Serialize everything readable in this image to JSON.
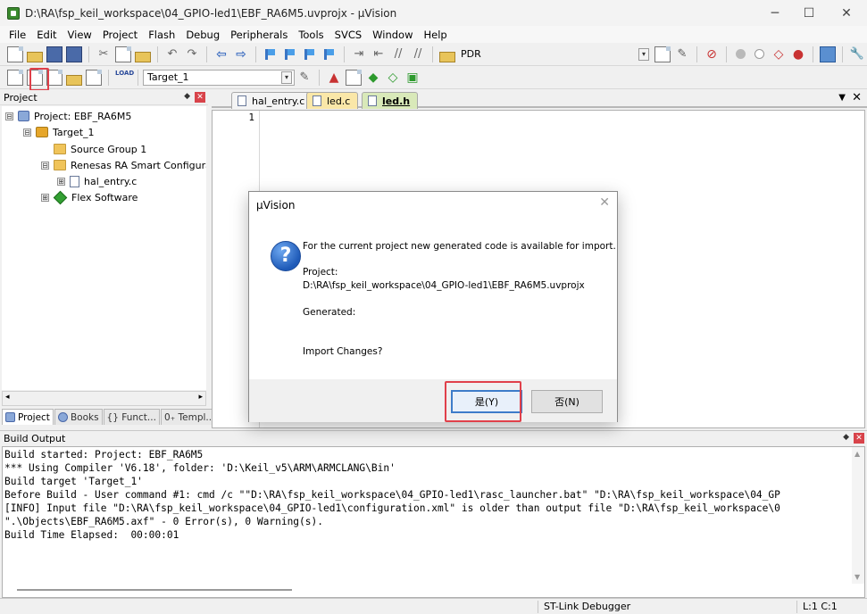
{
  "window": {
    "title": "D:\\RA\\fsp_keil_workspace\\04_GPIO-led1\\EBF_RA6M5.uvprojx - µVision",
    "controls": {
      "minimize": "─",
      "maximize": "☐",
      "close": "✕"
    }
  },
  "menu": [
    "File",
    "Edit",
    "View",
    "Project",
    "Flash",
    "Debug",
    "Peripherals",
    "Tools",
    "SVCS",
    "Window",
    "Help"
  ],
  "toolbar1": {
    "pdr_label": "PDR"
  },
  "toolbar2": {
    "target_select": "Target_1",
    "load_label": "LOAD"
  },
  "project_panel": {
    "title": "Project",
    "tree": [
      {
        "label": "Project: EBF_RA6M5",
        "expander": "⊟",
        "icon": "project-icon"
      },
      {
        "label": "Target_1",
        "expander": "⊟",
        "icon": "target-icon"
      },
      {
        "label": "Source Group 1",
        "expander": "",
        "icon": "folder-icon"
      },
      {
        "label": "Renesas RA Smart Configurato",
        "expander": "⊟",
        "icon": "folder-icon"
      },
      {
        "label": "hal_entry.c",
        "expander": "⊞",
        "icon": "file-icon"
      },
      {
        "label": "Flex Software",
        "expander": "⊞",
        "icon": "gem-icon"
      }
    ],
    "tabs": [
      {
        "label": "Project",
        "icon": "project-tab-icon"
      },
      {
        "label": "Books",
        "icon": "books-icon"
      },
      {
        "label": "{} Funct...",
        "icon": "functions-icon"
      },
      {
        "label": "0₊ Templ...",
        "icon": "templates-icon"
      }
    ]
  },
  "editor": {
    "tabs": [
      {
        "label": "hal_entry.c",
        "active": false
      },
      {
        "label": "led.c",
        "active": false
      },
      {
        "label": "led.h",
        "active": true
      }
    ],
    "line_number": "1"
  },
  "build_output": {
    "title": "Build Output",
    "lines": [
      "Build started: Project: EBF_RA6M5",
      "*** Using Compiler 'V6.18', folder: 'D:\\Keil_v5\\ARM\\ARMCLANG\\Bin'",
      "Build target 'Target_1'",
      "Before Build - User command #1: cmd /c \"\"D:\\RA\\fsp_keil_workspace\\04_GPIO-led1\\rasc_launcher.bat\" \"D:\\RA\\fsp_keil_workspace\\04_GP",
      "[INFO] Input file \"D:\\RA\\fsp_keil_workspace\\04_GPIO-led1\\configuration.xml\" is older than output file \"D:\\RA\\fsp_keil_workspace\\0",
      "\".\\Objects\\EBF_RA6M5.axf\" - 0 Error(s), 0 Warning(s).",
      "Build Time Elapsed:  00:00:01"
    ]
  },
  "status_bar": {
    "debugger": "ST-Link Debugger",
    "position": "L:1 C:1"
  },
  "dialog": {
    "title": "µVision",
    "message": "For the current project new generated code is available for import.",
    "project_label": "Project:",
    "project_path": "D:\\RA\\fsp_keil_workspace\\04_GPIO-led1\\EBF_RA6M5.uvprojx",
    "generated_label": "Generated:",
    "question": "Import Changes?",
    "yes_button": "是(Y)",
    "no_button": "否(N)",
    "icon": "question-icon"
  },
  "colors": {
    "highlight": "#e0404a",
    "accent": "#3d7cc9"
  }
}
